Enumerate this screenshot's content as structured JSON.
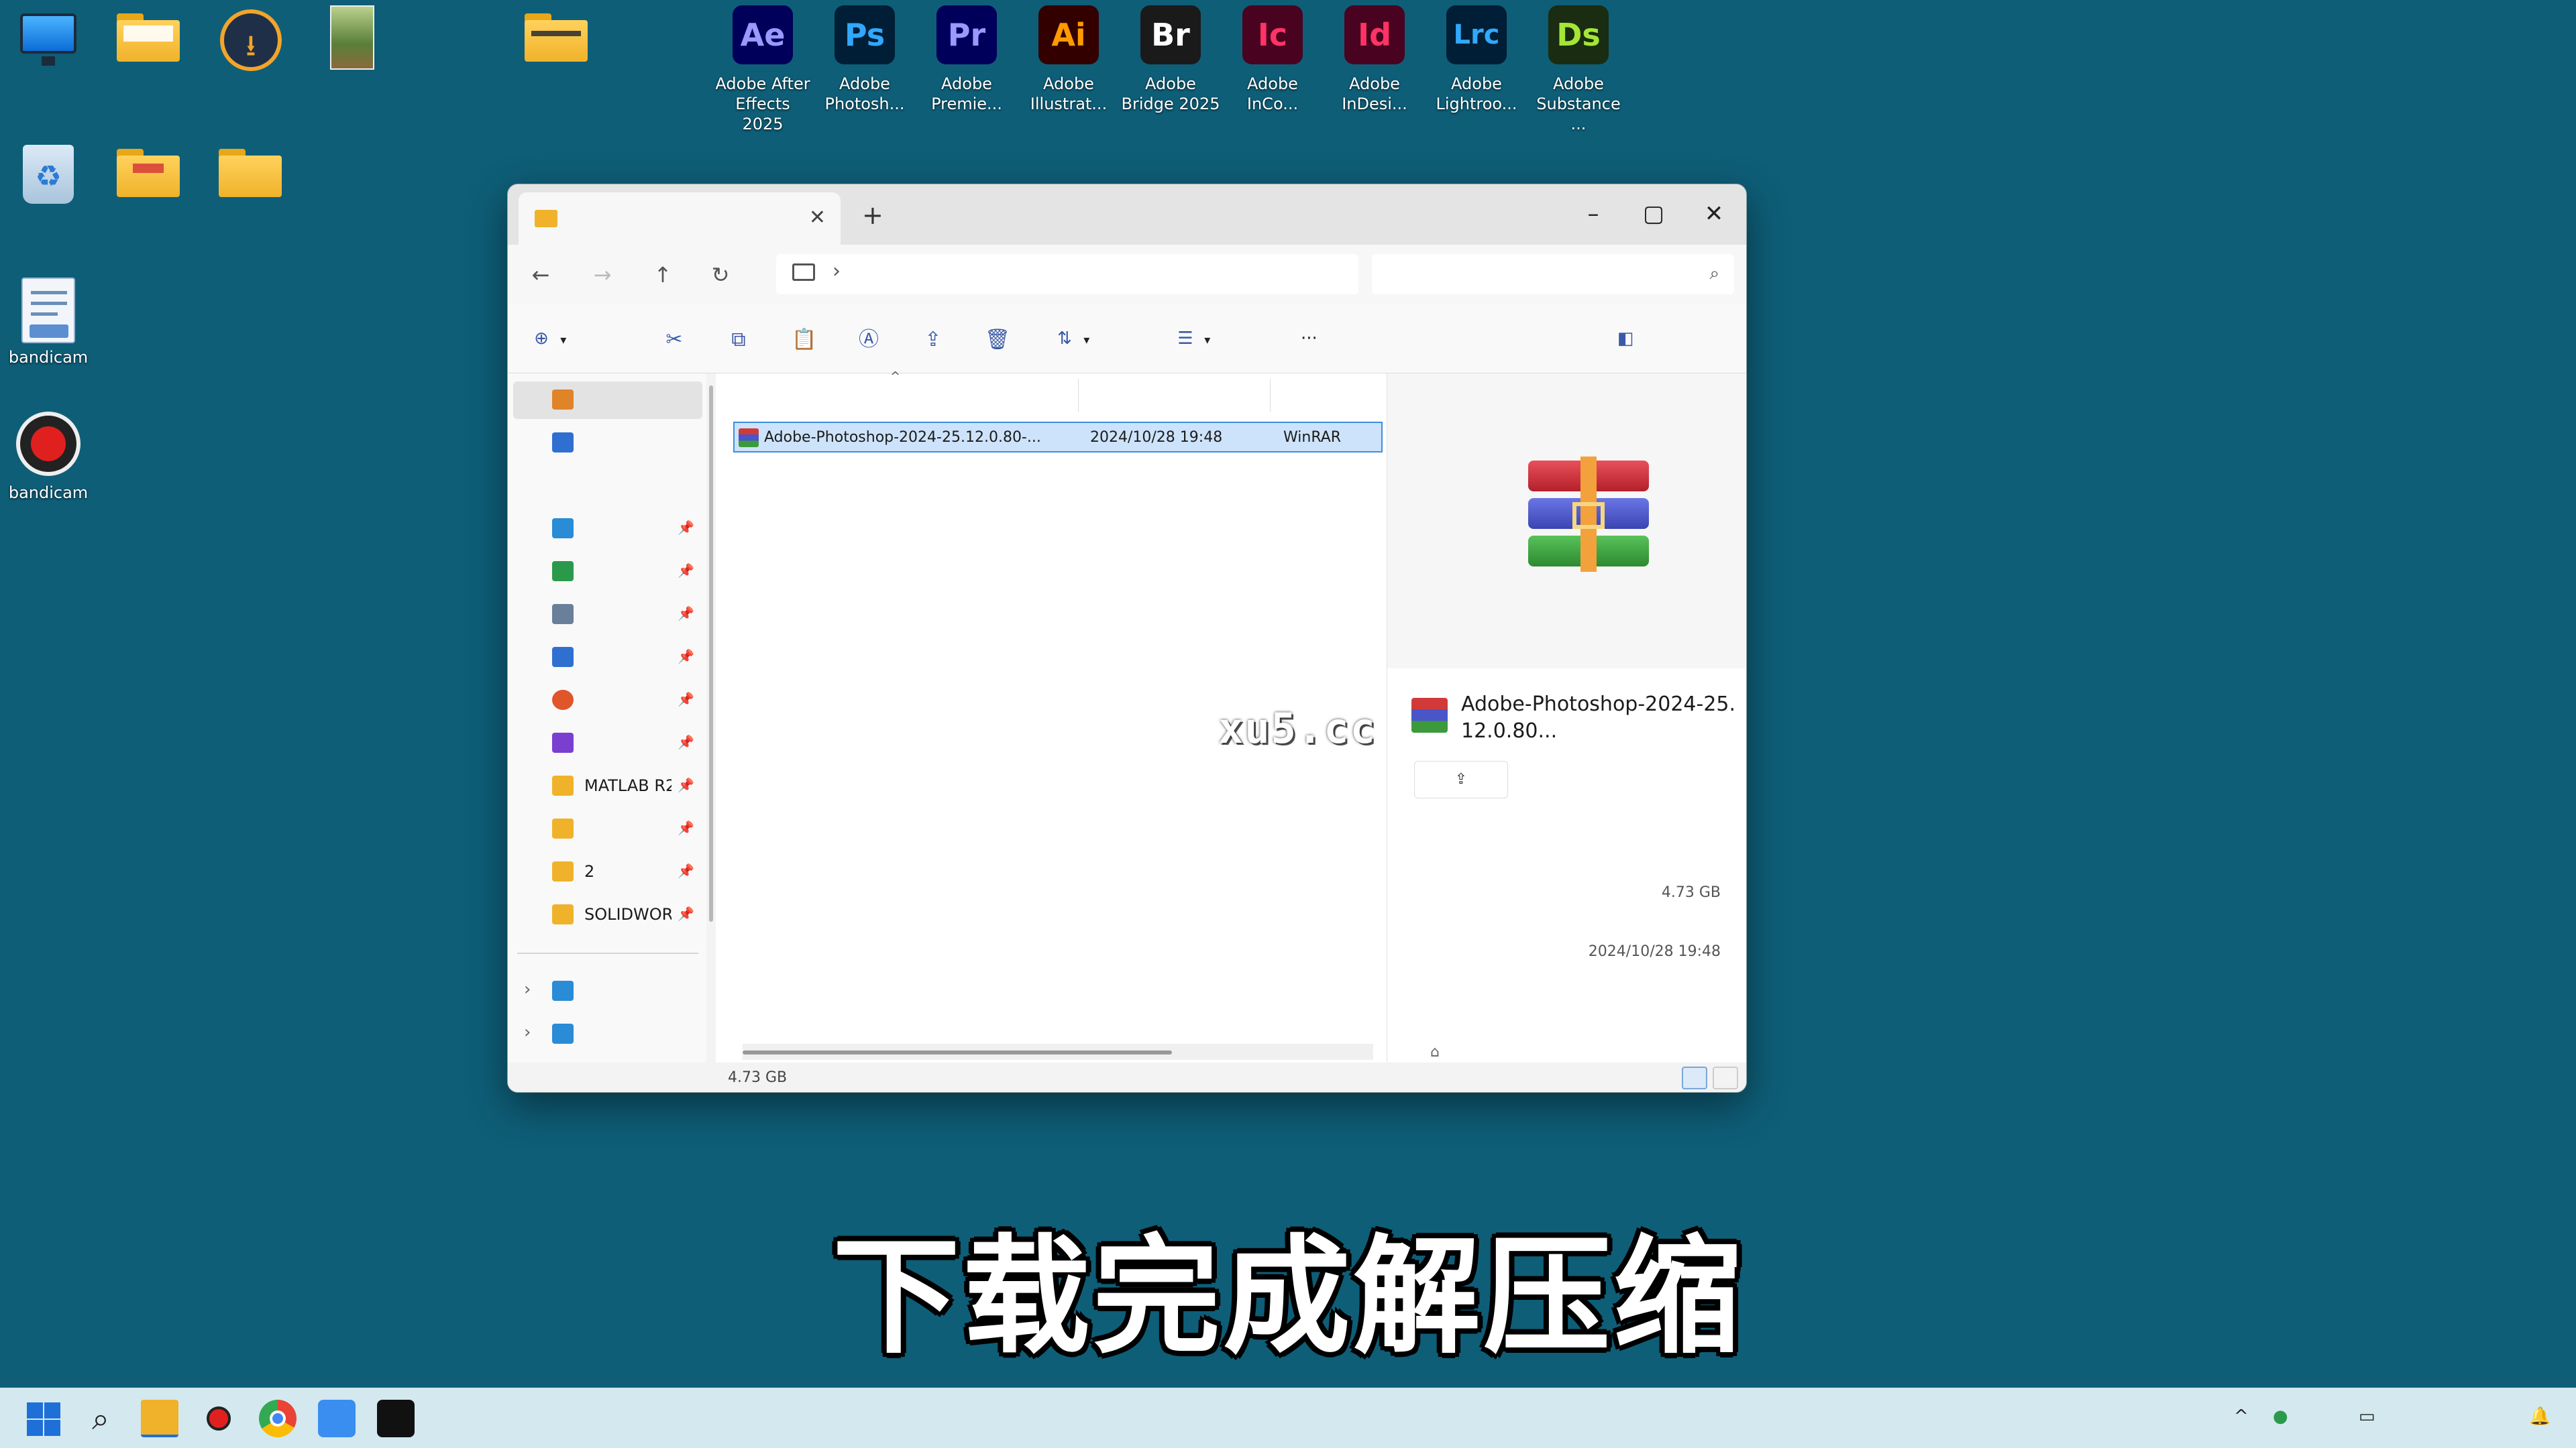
{
  "desktop": {
    "icons": [
      {
        "name": "this-pc",
        "label": ""
      },
      {
        "name": "folder-1",
        "label": ""
      },
      {
        "name": "downloader",
        "label": ""
      },
      {
        "name": "image-file",
        "label": ""
      },
      {
        "name": "new-folder",
        "label": ""
      },
      {
        "name": "recycle-bin",
        "label": ""
      },
      {
        "name": "folder-2",
        "label": ""
      },
      {
        "name": "folder-3",
        "label": ""
      },
      {
        "name": "bandicam-mp4",
        "label": "bandicam"
      },
      {
        "name": "bandicam-app",
        "label": "bandicam"
      }
    ],
    "adobe_apps": [
      {
        "abbr": "Ae",
        "label": "Adobe After Effects 2025",
        "bg": "#00005b",
        "fg": "#9999ff"
      },
      {
        "abbr": "Ps",
        "label": "Adobe Photosh...",
        "bg": "#001e36",
        "fg": "#31a8ff"
      },
      {
        "abbr": "Pr",
        "label": "Adobe Premie...",
        "bg": "#00005b",
        "fg": "#9999ff"
      },
      {
        "abbr": "Ai",
        "label": "Adobe Illustrat...",
        "bg": "#330000",
        "fg": "#ff9a00"
      },
      {
        "abbr": "Br",
        "label": "Adobe Bridge 2025",
        "bg": "#1a1a1a",
        "fg": "#ffffff"
      },
      {
        "abbr": "Ic",
        "label": "Adobe InCo...",
        "bg": "#49021f",
        "fg": "#ff3366"
      },
      {
        "abbr": "Id",
        "label": "Adobe InDesi...",
        "bg": "#49021f",
        "fg": "#ff3366"
      },
      {
        "abbr": "Lrc",
        "label": "Adobe Lightroo...",
        "bg": "#001e36",
        "fg": "#31a8ff"
      },
      {
        "abbr": "Ds",
        "label": "Adobe Substance ...",
        "bg": "#1a2c12",
        "fg": "#a3e635"
      }
    ]
  },
  "explorer": {
    "tab_title": "",
    "breadcrumb": "",
    "search_placeholder": "",
    "toolbar": {
      "new_label": "",
      "sort_label": "",
      "view_label": "",
      "more_label": "···",
      "details_label": ""
    },
    "nav": {
      "items": [
        {
          "label": "",
          "icon": "home-icon",
          "color": "#e0842a",
          "pinned": false
        },
        {
          "label": "",
          "icon": "gallery-icon",
          "color": "#2f6fd0",
          "pinned": false
        },
        {
          "label": "",
          "icon": "desktop-icon",
          "color": "#2a8bd6",
          "pinned": true
        },
        {
          "label": "",
          "icon": "download-icon",
          "color": "#2a9a4a",
          "pinned": true
        },
        {
          "label": "",
          "icon": "document-icon",
          "color": "#6a7f9a",
          "pinned": true
        },
        {
          "label": "",
          "icon": "pictures-icon",
          "color": "#2f6fd0",
          "pinned": true
        },
        {
          "label": "",
          "icon": "music-icon",
          "color": "#e0552a",
          "pinned": true
        },
        {
          "label": "",
          "icon": "videos-icon",
          "color": "#7a3fd0",
          "pinned": true
        },
        {
          "label": "MATLAB R2",
          "icon": "folder-icon",
          "color": "#f0b22a",
          "pinned": true
        },
        {
          "label": "",
          "icon": "folder-icon",
          "color": "#f0b22a",
          "pinned": true
        },
        {
          "label": "2",
          "icon": "folder-icon",
          "color": "#f0b22a",
          "pinned": true
        },
        {
          "label": "SOLIDWOR",
          "icon": "folder-icon",
          "color": "#f0b22a",
          "pinned": true
        }
      ],
      "bottom": [
        {
          "label": "",
          "icon": "pc-icon",
          "color": "#2a8bd6"
        },
        {
          "label": "",
          "icon": "network-icon",
          "color": "#2a8bd6"
        }
      ]
    },
    "columns": [
      "",
      "",
      ""
    ],
    "files": [
      {
        "name": "Adobe-Photoshop-2024-25.12.0.80-...",
        "date": "2024/10/28 19:48",
        "type": "WinRAR"
      }
    ],
    "details": {
      "title": "Adobe-Photoshop-2024-25.12.0.80...",
      "share_label": "",
      "section": "",
      "rows": [
        {
          "key": "",
          "value": ""
        },
        {
          "key": "",
          "value": "4.73 GB"
        },
        {
          "key": "",
          "value": ""
        },
        {
          "key": "",
          "value": "2024/10/28 19:48"
        }
      ],
      "tags_label": ""
    },
    "status": {
      "count": "",
      "selected": "",
      "size": "4.73 GB"
    }
  },
  "overlay": {
    "watermark": "xu5.cc",
    "caption": "下载完成解压缩"
  },
  "taskbar": {
    "lang": "",
    "ime": "",
    "time": "",
    "date": ""
  }
}
